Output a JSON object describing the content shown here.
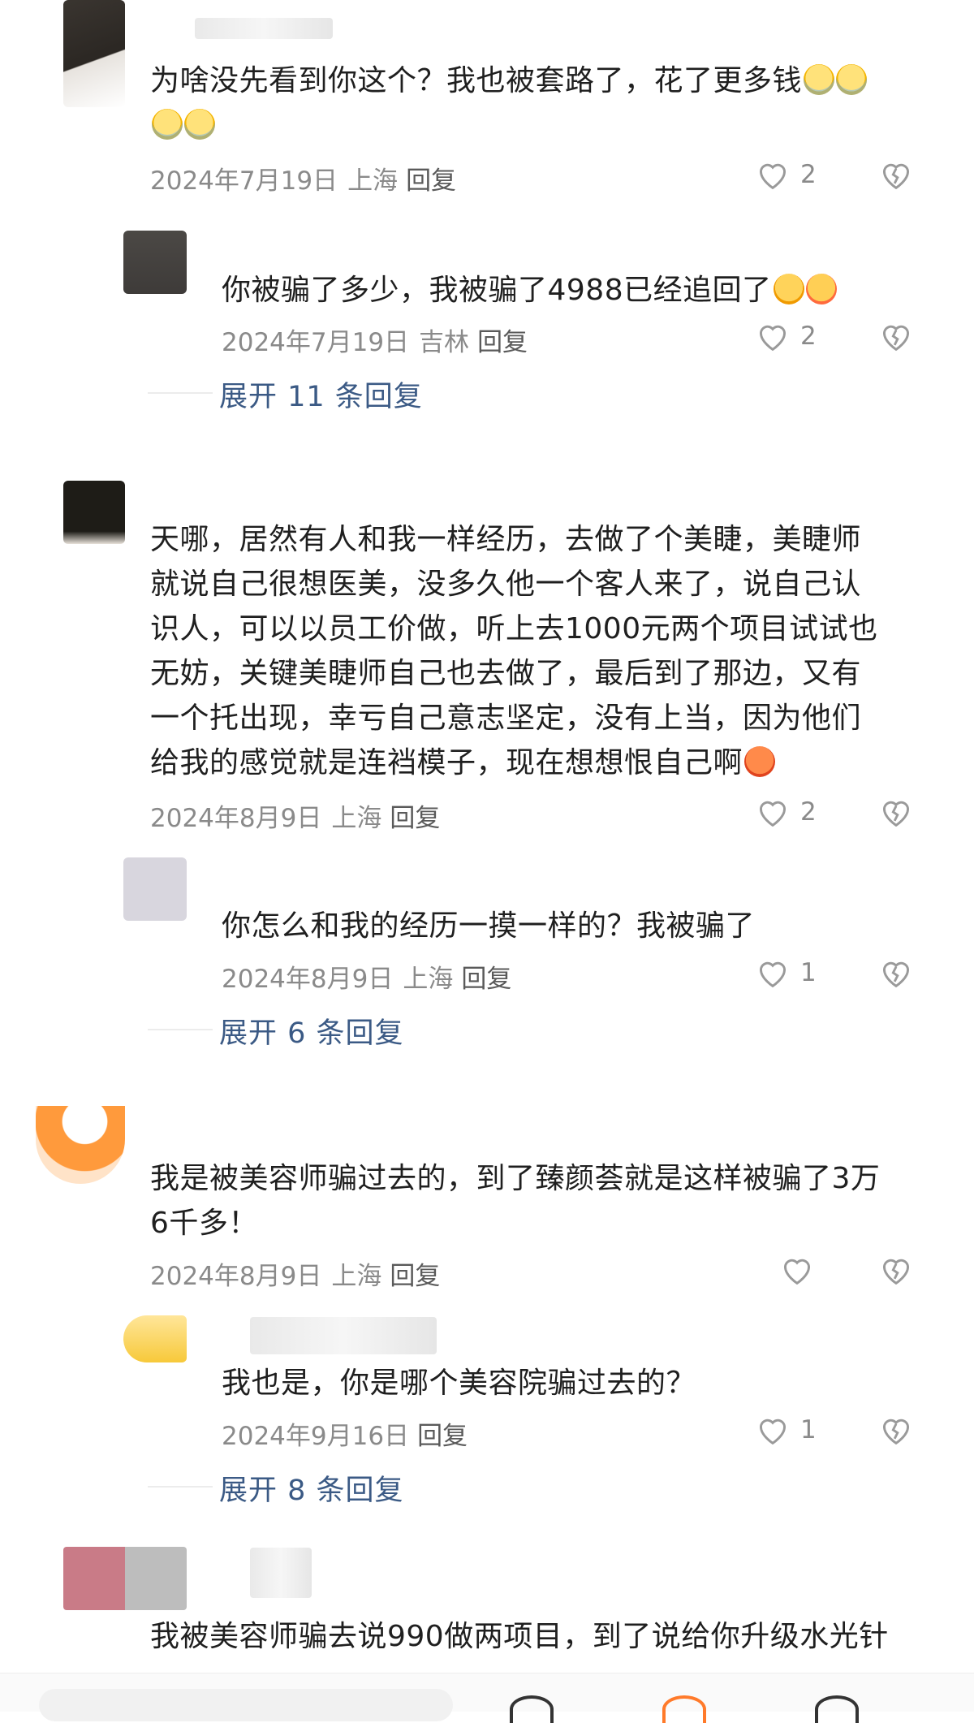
{
  "comments": [
    {
      "text": "为啥没先看到你这个？我也被套路了，花了更多钱",
      "text_line2_emoji_count": 2,
      "date": "2024年7月19日",
      "location": "上海",
      "reply_label": "回复",
      "likes": "2",
      "replies": [
        {
          "text": "你被骗了多少，我被骗了4988已经追回了",
          "date": "2024年7月19日",
          "location": "吉林",
          "reply_label": "回复",
          "likes": "2"
        }
      ],
      "expand_label": "展开 11 条回复"
    },
    {
      "text_lines": [
        "天哪，居然有人和我一样经历，去做了个美睫，美睫师",
        "就说自己很想医美，没多久他一个客人来了，说自己认",
        "识人，可以以员工价做，听上去1000元两个项目试试也",
        "无妨，关键美睫师自己也去做了，最后到了那边，又有",
        "一个托出现，幸亏自己意志坚定，没有上当，因为他们",
        "给我的感觉就是连裆模子，现在想想恨自己啊"
      ],
      "date": "2024年8月9日",
      "location": "上海",
      "reply_label": "回复",
      "likes": "2",
      "replies": [
        {
          "text": "你怎么和我的经历一摸一样的？我被骗了",
          "date": "2024年8月9日",
          "location": "上海",
          "reply_label": "回复",
          "likes": "1"
        }
      ],
      "expand_label": "展开 6 条回复"
    },
    {
      "text_lines": [
        "我是被美容师骗过去的，到了臻颜荟就是这样被骗了3万",
        "6千多！"
      ],
      "date": "2024年8月9日",
      "location": "上海",
      "reply_label": "回复",
      "likes": "",
      "replies": [
        {
          "text": "我也是，你是哪个美容院骗过去的？",
          "date": "2024年9月16日",
          "reply_label": "回复",
          "likes": "1"
        }
      ],
      "expand_label": "展开 8 条回复"
    },
    {
      "text_lines": [
        "我被美容师骗去说990做两项目，到了说给你升级水光针"
      ]
    }
  ],
  "icons": {
    "like": "heart-outline-icon",
    "dislike": "broken-heart-icon"
  },
  "colors": {
    "expand_link": "#3b5a85",
    "meta_text": "#8a8a8a"
  }
}
